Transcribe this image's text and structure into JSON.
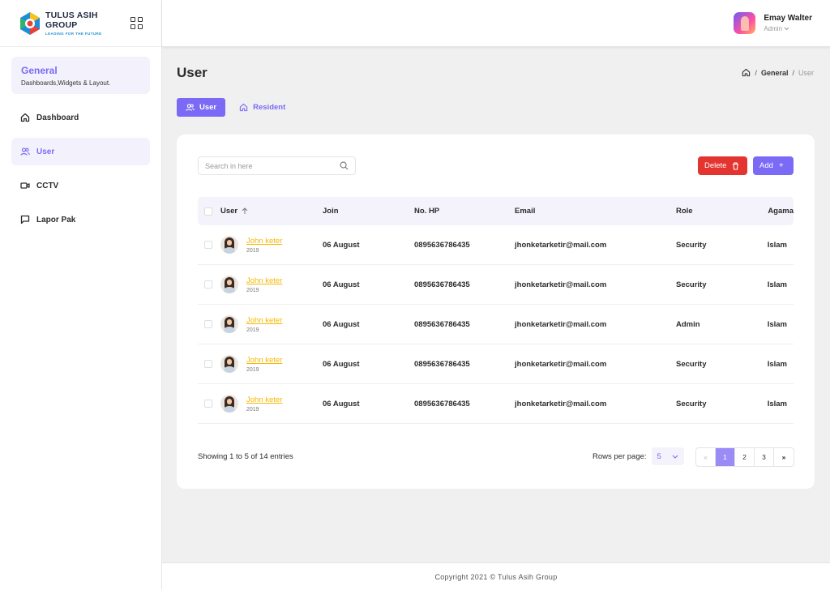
{
  "brand": {
    "title": "TULUS ASIH GROUP",
    "subtitle": "LEADING FOR THE FUTURE"
  },
  "sidebar": {
    "section": {
      "title": "General",
      "subtitle": "Dashboards,Widgets & Layout."
    },
    "items": [
      {
        "label": "Dashboard",
        "icon": "home-icon"
      },
      {
        "label": "User",
        "icon": "users-icon"
      },
      {
        "label": "CCTV",
        "icon": "video-icon"
      },
      {
        "label": "Lapor Pak",
        "icon": "message-icon"
      }
    ]
  },
  "header": {
    "user_name": "Emay Walter",
    "user_role": "Admin"
  },
  "page": {
    "title": "User",
    "breadcrumb": [
      "General",
      "User"
    ]
  },
  "tabs": [
    {
      "label": "User"
    },
    {
      "label": "Resident"
    }
  ],
  "search": {
    "placeholder": "Search in here"
  },
  "actions": {
    "delete_label": "Delete",
    "add_label": "Add"
  },
  "table": {
    "columns": [
      "User",
      "Join",
      "No. HP",
      "Email",
      "Role",
      "Agama"
    ],
    "rows": [
      {
        "name": "John keter",
        "year": "2019",
        "join": "06 August",
        "hp": "0895636786435",
        "email": "jhonketarketir@mail.com",
        "role": "Security",
        "agama": "Islam"
      },
      {
        "name": "John keter",
        "year": "2019",
        "join": "06 August",
        "hp": "0895636786435",
        "email": "jhonketarketir@mail.com",
        "role": "Security",
        "agama": "Islam"
      },
      {
        "name": "John keter",
        "year": "2019",
        "join": "06 August",
        "hp": "0895636786435",
        "email": "jhonketarketir@mail.com",
        "role": "Admin",
        "agama": "Islam"
      },
      {
        "name": "John keter",
        "year": "2019",
        "join": "06 August",
        "hp": "0895636786435",
        "email": "jhonketarketir@mail.com",
        "role": "Security",
        "agama": "Islam"
      },
      {
        "name": "John keter",
        "year": "2019",
        "join": "06 August",
        "hp": "0895636786435",
        "email": "jhonketarketir@mail.com",
        "role": "Security",
        "agama": "Islam"
      }
    ]
  },
  "pagination": {
    "info": "Showing 1 to 5 of 14 entries",
    "rows_label": "Rows per page:",
    "rows_value": "5",
    "first": "«",
    "last": "»",
    "pages": [
      "1",
      "2",
      "3"
    ],
    "current": "1"
  },
  "footer": {
    "copyright": "Copyright 2021 © Tulus Asih Group"
  },
  "colors": {
    "accent": "#7a6af5",
    "danger": "#e3342f",
    "link": "#f5b800"
  }
}
